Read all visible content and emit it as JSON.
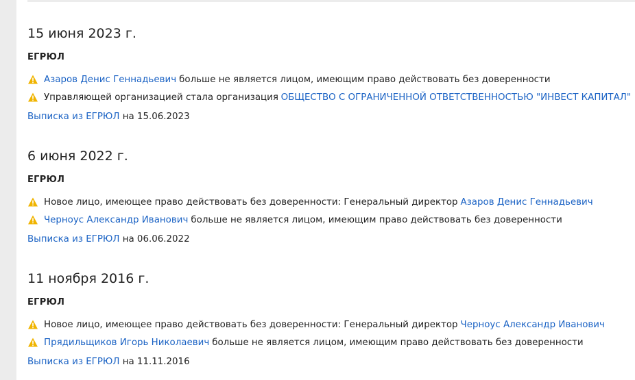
{
  "entries": [
    {
      "date": "15 июня 2023 г.",
      "source": "ЕГРЮЛ",
      "events": [
        {
          "link": "Азаров Денис Геннадьевич",
          "text": "больше не является лицом, имеющим право действовать без доверенности"
        },
        {
          "text": "Управляющей организацией стала организация",
          "link": "ОБЩЕСТВО С ОГРАНИЧЕННОЙ ОТВЕТСТВЕННОСТЬЮ \"ИНВЕСТ КАПИТАЛ\""
        }
      ],
      "extract_link": "Выписка из ЕГРЮЛ",
      "extract_suffix": "на 15.06.2023"
    },
    {
      "date": "6 июня 2022 г.",
      "source": "ЕГРЮЛ",
      "events": [
        {
          "text": "Новое лицо, имеющее право действовать без доверенности: Генеральный директор",
          "link": "Азаров Денис Геннадьевич"
        },
        {
          "link": "Черноус Александр Иванович",
          "text": "больше не является лицом, имеющим право действовать без доверенности"
        }
      ],
      "extract_link": "Выписка из ЕГРЮЛ",
      "extract_suffix": "на 06.06.2022"
    },
    {
      "date": "11 ноября 2016 г.",
      "source": "ЕГРЮЛ",
      "events": [
        {
          "text": "Новое лицо, имеющее право действовать без доверенности: Генеральный директор",
          "link": "Черноус Александр Иванович"
        },
        {
          "link": "Прядильщиков Игорь Николаевич",
          "text": "больше не является лицом, имеющим право действовать без доверенности"
        }
      ],
      "extract_link": "Выписка из ЕГРЮЛ",
      "extract_suffix": "на 11.11.2016"
    }
  ],
  "colors": {
    "link": "#1a62c4",
    "warning": "#f0b400"
  },
  "icons": {
    "event": "warning-icon"
  }
}
